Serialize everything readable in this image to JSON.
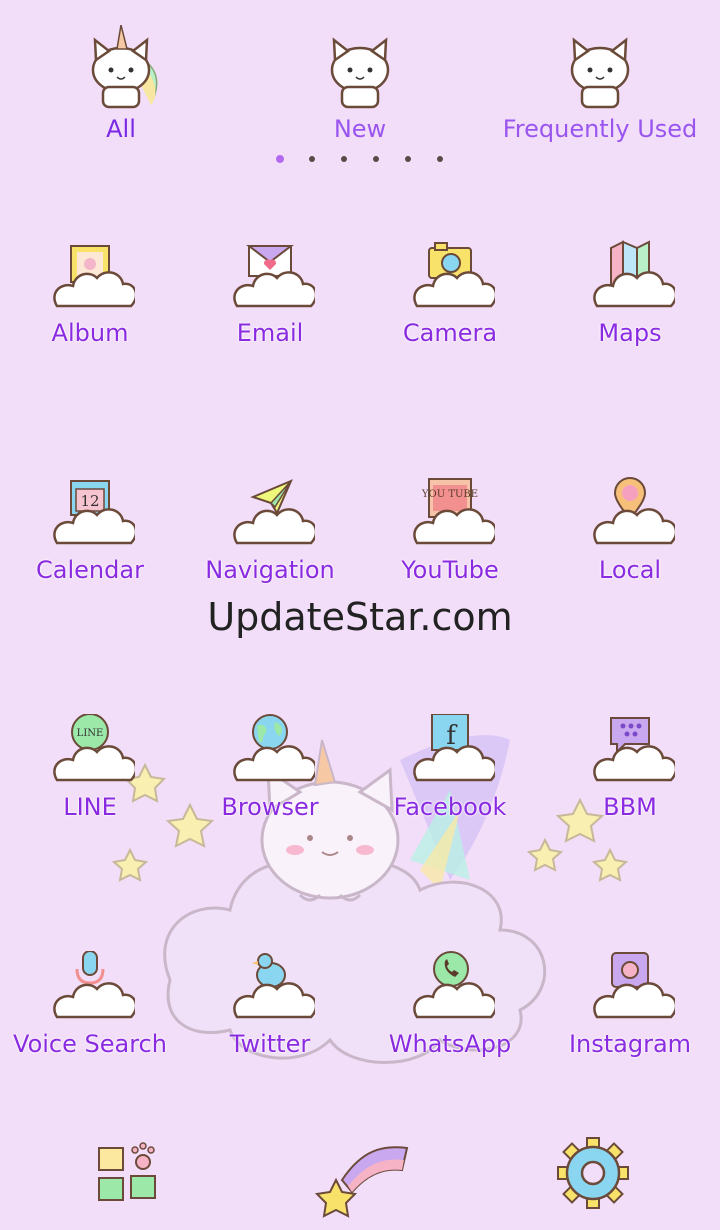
{
  "tabs": [
    {
      "label": "All",
      "active": true
    },
    {
      "label": "New",
      "active": false
    },
    {
      "label": "Frequently Used",
      "active": false
    }
  ],
  "page_indicator": {
    "pages": 6,
    "current": 1
  },
  "apps": [
    {
      "label": "Album",
      "icon": "album-icon"
    },
    {
      "label": "Email",
      "icon": "email-icon"
    },
    {
      "label": "Camera",
      "icon": "camera-icon"
    },
    {
      "label": "Maps",
      "icon": "maps-icon"
    },
    {
      "label": "Calendar",
      "icon": "calendar-icon",
      "icon_text": "12"
    },
    {
      "label": "Navigation",
      "icon": "paper-plane-icon"
    },
    {
      "label": "YouTube",
      "icon": "youtube-icon",
      "icon_text": "YOU TUBE"
    },
    {
      "label": "Local",
      "icon": "location-pin-icon"
    },
    {
      "label": "LINE",
      "icon": "line-icon",
      "icon_text": "LINE"
    },
    {
      "label": "Browser",
      "icon": "globe-icon"
    },
    {
      "label": "Facebook",
      "icon": "facebook-icon",
      "icon_text": "f"
    },
    {
      "label": "BBM",
      "icon": "bbm-icon"
    },
    {
      "label": "Voice Search",
      "icon": "microphone-icon"
    },
    {
      "label": "Twitter",
      "icon": "bird-icon"
    },
    {
      "label": "WhatsApp",
      "icon": "whatsapp-icon"
    },
    {
      "label": "Instagram",
      "icon": "instagram-icon"
    }
  ],
  "watermark": "UpdateStar.com",
  "dock": [
    {
      "icon": "app-grid-icon"
    },
    {
      "icon": "shooting-star-icon"
    },
    {
      "icon": "settings-gear-icon"
    }
  ],
  "colors": {
    "background": "#f2def8",
    "label": "#8a2be2",
    "tab_inactive": "#9a55ef"
  }
}
